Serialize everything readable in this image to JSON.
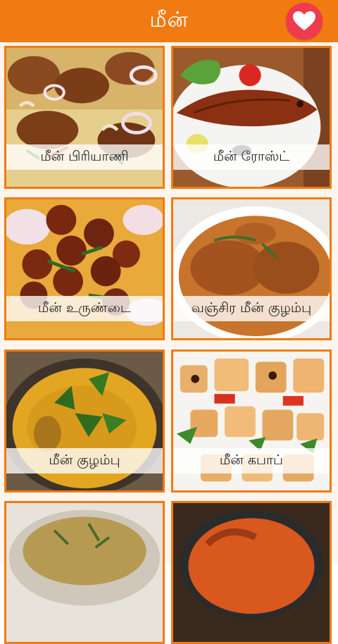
{
  "header": {
    "title": "மீன்",
    "favorite_icon": "heart-icon",
    "background_color": "#f27a12",
    "favorite_color": "#ef3a4f"
  },
  "recipes": [
    {
      "label": "மீன் பிரியாணி"
    },
    {
      "label": "மீன் ரோஸ்ட்"
    },
    {
      "label": "மீன் உருண்டை"
    },
    {
      "label": "வஞ்சிர மீன் குழம்பு"
    },
    {
      "label": "மீன் குழம்பு"
    },
    {
      "label": "மீன் கபாப்"
    },
    {
      "label": ""
    },
    {
      "label": ""
    }
  ]
}
